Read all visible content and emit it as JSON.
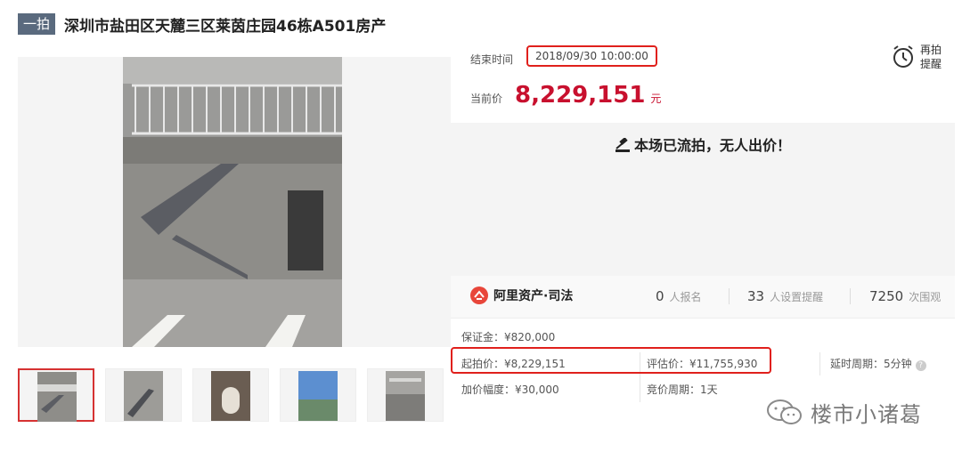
{
  "header": {
    "badge": "一拍",
    "title": "深圳市盐田区天麓三区莱茵庄园46栋A501房产"
  },
  "auction": {
    "end_time_label": "结束时间",
    "end_time": "2018/09/30 10:00:00",
    "remind_label_1": "再拍",
    "remind_label_2": "提醒",
    "current_price_label": "当前价",
    "current_price": "8,229,151",
    "price_unit": "元",
    "status": "本场已流拍，无人出价！"
  },
  "stats": {
    "brand": "阿里资产·司法",
    "signups_count": "0",
    "signups_label": "人报名",
    "reminders_count": "33",
    "reminders_label": "人设置提醒",
    "views_count": "7250",
    "views_label": "次围观"
  },
  "details": {
    "deposit": "保证金：¥820,000",
    "start_price": "起拍价：¥8,229,151",
    "appraisal": "评估价：¥11,755,930",
    "extension": "延时周期：5分钟",
    "increment": "加价幅度：¥30,000",
    "bidding_period": "竞价周期：1天"
  },
  "watermark": "楼市小诸葛",
  "colors": {
    "accent_red": "#c8102e",
    "highlight_box": "#e0201c",
    "badge_bg": "#5a6a7e"
  },
  "icons": [
    "alarm-clock-icon",
    "gavel-icon",
    "alibaba-asset-logo-icon",
    "help-icon",
    "wechat-icon"
  ]
}
